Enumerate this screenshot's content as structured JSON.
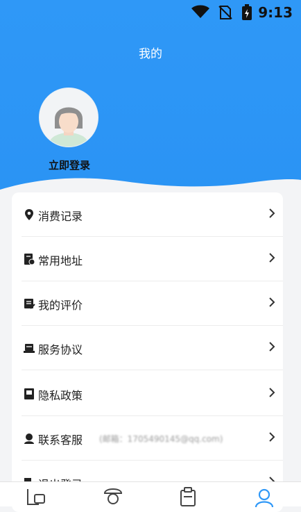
{
  "status_bar": {
    "time": "9:13"
  },
  "header": {
    "title": "我的"
  },
  "profile": {
    "login_label": "立即登录"
  },
  "menu": {
    "items": [
      {
        "label": "消费记录",
        "icon": "location-pin-icon"
      },
      {
        "label": "常用地址",
        "icon": "address-book-icon"
      },
      {
        "label": "我的评价",
        "icon": "review-note-icon"
      },
      {
        "label": "服务协议",
        "icon": "agreement-icon"
      },
      {
        "label": "隐私政策",
        "icon": "privacy-book-icon"
      },
      {
        "label": "联系客服",
        "icon": "customer-service-icon",
        "extra": "(邮箱：1705490145@qq.com)"
      },
      {
        "label": "退出登录",
        "icon": "logout-icon"
      }
    ]
  },
  "tabbar": {
    "tabs": [
      {
        "icon": "home-tab-icon"
      },
      {
        "icon": "service-tab-icon"
      },
      {
        "icon": "orders-tab-icon"
      },
      {
        "icon": "profile-tab-icon",
        "active": true
      }
    ]
  },
  "colors": {
    "primary": "#2f98f7",
    "card": "#ffffff",
    "background": "#f3f4f6"
  }
}
